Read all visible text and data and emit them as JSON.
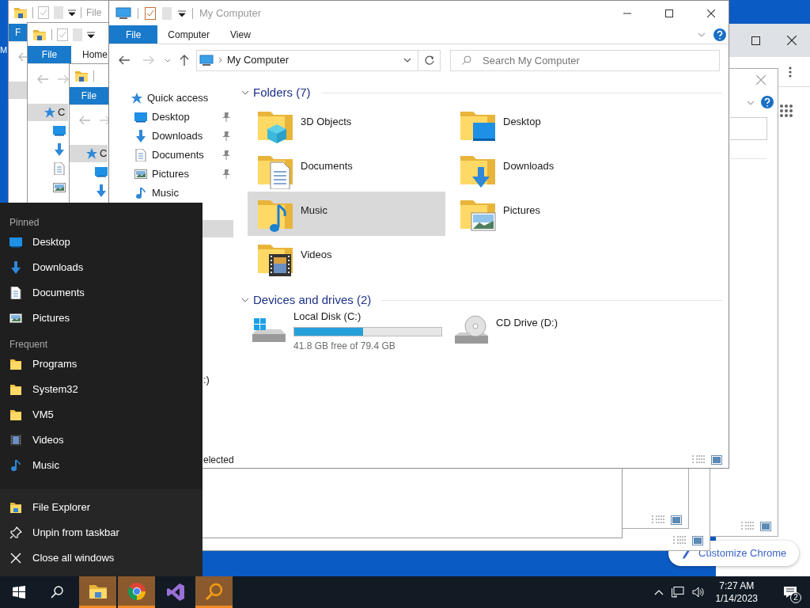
{
  "desktop": {
    "label_fragment": "M"
  },
  "chrome_window": {
    "button": "Customize Chrome"
  },
  "back_windows": [
    {
      "title": "File",
      "tabs": [
        {
          "label": "F",
          "selected": true
        }
      ]
    },
    {
      "tabs": [
        {
          "label": "File",
          "selected": true
        },
        {
          "label": "Home",
          "selected": false
        }
      ],
      "nav_fragment": "C"
    },
    {
      "tabs": [
        {
          "label": "File",
          "selected": true
        }
      ],
      "nav_fragment": "C"
    }
  ],
  "window": {
    "title": "My Computer",
    "tabs": [
      {
        "label": "File",
        "selected": true
      },
      {
        "label": "Computer",
        "selected": false
      },
      {
        "label": "View",
        "selected": false
      }
    ],
    "address": "My Computer",
    "search": {
      "placeholder": "Search My Computer"
    },
    "sidebar": {
      "items": [
        {
          "label": "Quick access",
          "kind": "star",
          "pinned": false
        },
        {
          "label": "Desktop",
          "kind": "desktop",
          "pinned": true
        },
        {
          "label": "Downloads",
          "kind": "downloads",
          "pinned": true
        },
        {
          "label": "Documents",
          "kind": "documents",
          "pinned": true
        },
        {
          "label": "Pictures",
          "kind": "pictures",
          "pinned": true
        },
        {
          "label": "Music",
          "kind": "music",
          "pinned": false
        }
      ],
      "fragment": ":)"
    },
    "groups": [
      {
        "title": "Folders (7)",
        "expanded": true,
        "items": [
          {
            "label": "3D Objects",
            "kind": "objects",
            "selected": false
          },
          {
            "label": "Desktop",
            "kind": "desktop",
            "selected": false
          },
          {
            "label": "Documents",
            "kind": "documents",
            "selected": false
          },
          {
            "label": "Downloads",
            "kind": "downloads",
            "selected": false
          },
          {
            "label": "Music",
            "kind": "music",
            "selected": true
          },
          {
            "label": "Pictures",
            "kind": "pictures",
            "selected": false
          },
          {
            "label": "Videos",
            "kind": "videos",
            "selected": false
          }
        ]
      },
      {
        "title": "Devices and drives (2)",
        "expanded": true,
        "items": [
          {
            "label": "Local Disk (C:)",
            "kind": "disk",
            "level": 0.47,
            "detail": "41.8 GB free of 79.4 GB"
          },
          {
            "label": "CD Drive (D:)",
            "kind": "cd"
          }
        ]
      }
    ],
    "status_bar": "elected"
  },
  "jump_list": {
    "sections": [
      {
        "title": "Pinned",
        "items": [
          {
            "label": "Desktop",
            "kind": "desktop"
          },
          {
            "label": "Downloads",
            "kind": "downloads"
          },
          {
            "label": "Documents",
            "kind": "documents"
          },
          {
            "label": "Pictures",
            "kind": "pictures"
          }
        ]
      },
      {
        "title": "Frequent",
        "items": [
          {
            "label": "Programs",
            "kind": "folder"
          },
          {
            "label": "System32",
            "kind": "folder"
          },
          {
            "label": "VM5",
            "kind": "folder"
          },
          {
            "label": "Videos",
            "kind": "videos"
          },
          {
            "label": "Music",
            "kind": "music"
          }
        ]
      }
    ],
    "tasks": [
      {
        "label": "File Explorer",
        "kind": "explorer"
      },
      {
        "label": "Unpin from taskbar",
        "kind": "unpin"
      },
      {
        "label": "Close all windows",
        "kind": "close"
      }
    ]
  },
  "taskbar": {
    "apps": [
      {
        "kind": "explorer",
        "running": true
      },
      {
        "kind": "chrome",
        "running": true
      },
      {
        "kind": "vs",
        "running": false
      },
      {
        "kind": "magnifier",
        "running": true
      }
    ],
    "clock": {
      "time": "7:27 AM",
      "date": "1/14/2023"
    },
    "notifications": "2"
  }
}
